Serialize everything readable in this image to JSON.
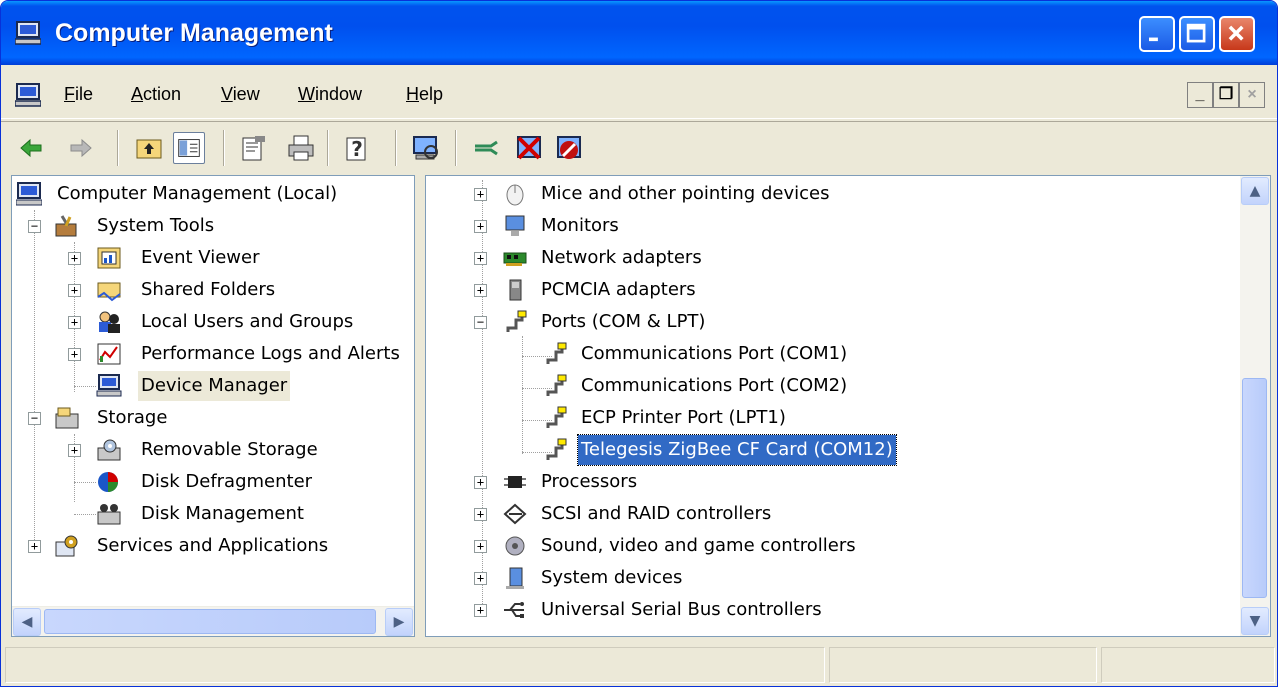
{
  "window": {
    "title": "Computer Management",
    "icon": "computer-icon"
  },
  "menu": {
    "items": [
      "File",
      "Action",
      "View",
      "Window",
      "Help"
    ],
    "mnemonics": [
      "F",
      "A",
      "V",
      "W",
      "H"
    ]
  },
  "mdi_buttons": {
    "minimize": "_",
    "restore": "❐",
    "close": "×"
  },
  "toolbar": {
    "icons": [
      "back-arrow-icon",
      "forward-arrow-icon",
      "up-folder-icon",
      "show-hide-tree-icon",
      "properties-icon",
      "print-icon",
      "help-icon",
      "scan-hardware-icon",
      "update-driver-icon",
      "disable-device-icon",
      "uninstall-device-icon"
    ]
  },
  "left_tree": {
    "root": "Computer Management (Local)",
    "system_tools": "System Tools",
    "event_viewer": "Event Viewer",
    "shared_folders": "Shared Folders",
    "local_users": "Local Users and Groups",
    "perf_logs": "Performance Logs and Alerts",
    "device_manager": "Device Manager",
    "storage": "Storage",
    "removable_storage": "Removable Storage",
    "disk_defrag": "Disk Defragmenter",
    "disk_mgmt": "Disk Management",
    "services": "Services and Applications"
  },
  "device_tree": {
    "mice": "Mice and other pointing devices",
    "monitors": "Monitors",
    "network": "Network adapters",
    "pcmcia": "PCMCIA adapters",
    "ports": "Ports (COM & LPT)",
    "com1": "Communications Port (COM1)",
    "com2": "Communications Port (COM2)",
    "lpt1": "ECP Printer Port (LPT1)",
    "zigbee": "Telegesis ZigBee CF Card (COM12)",
    "processors": "Processors",
    "scsi": "SCSI and RAID controllers",
    "sound": "Sound, video and game controllers",
    "system": "System devices",
    "usb": "Universal Serial Bus controllers"
  },
  "colors": {
    "title_blue": "#0054e3",
    "selection": "#316ac5",
    "face": "#ece9d8"
  }
}
